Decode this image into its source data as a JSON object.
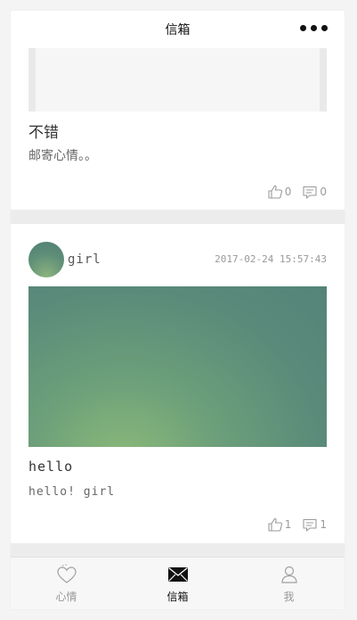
{
  "navbar": {
    "title": "信箱"
  },
  "posts": [
    {
      "title": "不错",
      "text": "邮寄心情。。",
      "likes": "0",
      "comments": "0"
    },
    {
      "username": "girl",
      "timestamp": "2017-02-24 15:57:43",
      "title": "hello",
      "text": "hello! girl",
      "likes": "1",
      "comments": "1"
    }
  ],
  "tabbar": {
    "items": [
      {
        "label": "心情",
        "icon": "heart-icon"
      },
      {
        "label": "信箱",
        "icon": "envelope-icon"
      },
      {
        "label": "我",
        "icon": "user-icon"
      }
    ],
    "active_index": 1
  },
  "colors": {
    "background": "#ececec",
    "card": "#ffffff",
    "text_primary": "#333333",
    "text_secondary": "#999999"
  }
}
